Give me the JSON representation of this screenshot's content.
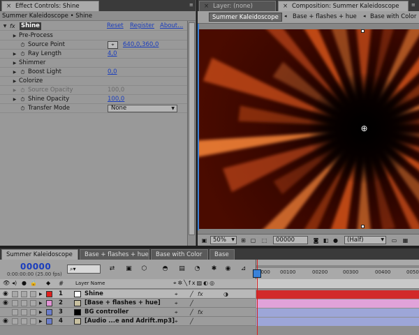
{
  "effect_controls": {
    "tab_label": "Effect Controls: Shine",
    "breadcrumb": "Summer Kaleidoscope • Shine",
    "effect_name": "Shine",
    "reset": "Reset",
    "register": "Register",
    "about": "About...",
    "rows": {
      "pre_process": "Pre-Process",
      "source_point": "Source Point",
      "source_point_value": "640,0,360,0",
      "ray_length": "Ray Length",
      "ray_length_value": "4,0",
      "shimmer": "Shimmer",
      "boost_light": "Boost Light",
      "boost_light_value": "0,0",
      "colorize": "Colorize",
      "source_opacity": "Source Opacity",
      "source_opacity_value": "100,0",
      "shine_opacity": "Shine Opacity",
      "shine_opacity_value": "100,0",
      "transfer_mode": "Transfer Mode",
      "transfer_mode_value": "None"
    }
  },
  "composition": {
    "layer_tab": "Layer: (none)",
    "comp_tab": "Composition: Summer Kaleidoscope",
    "crumbs": [
      "Summer Kaleidoscope",
      "Base + flashes + hue",
      "Base with Color"
    ],
    "zoom": "50%",
    "timecode": "00000",
    "resolution": "(Half)"
  },
  "timeline": {
    "tabs": [
      "Summer Kaleidoscope",
      "Base + flashes + hue",
      "Base with Color",
      "Base"
    ],
    "timecode": "00000",
    "timecode_sub": "0:00:00:00 (25.00 fps)",
    "search_placeholder": "⌕▾",
    "col_number": "#",
    "col_layer_name": "Layer Name",
    "ruler_ticks": [
      "00100",
      "00200",
      "00300",
      "00400",
      "00500"
    ],
    "ruler_start": "0000",
    "layers": [
      {
        "num": "1",
        "name": "Shine",
        "label_color": "#e0201e",
        "bar_color": "#d22a2a"
      },
      {
        "num": "2",
        "name": "[Base + flashes + hue]",
        "label_color": "#e493d6",
        "bar_color": "#e1a2d9"
      },
      {
        "num": "3",
        "name": "BG controller",
        "label_color": "#6c7ecb",
        "bar_color": "#9da6d8"
      },
      {
        "num": "4",
        "name": "[Audio ...e and Adrift.mp3]",
        "label_color": "#6c7ecb",
        "bar_color": "#9da6d8"
      }
    ]
  },
  "colors": {
    "panel_bg": "#999999",
    "link_blue": "#1a3dbd",
    "playhead": "#d31f1f"
  }
}
